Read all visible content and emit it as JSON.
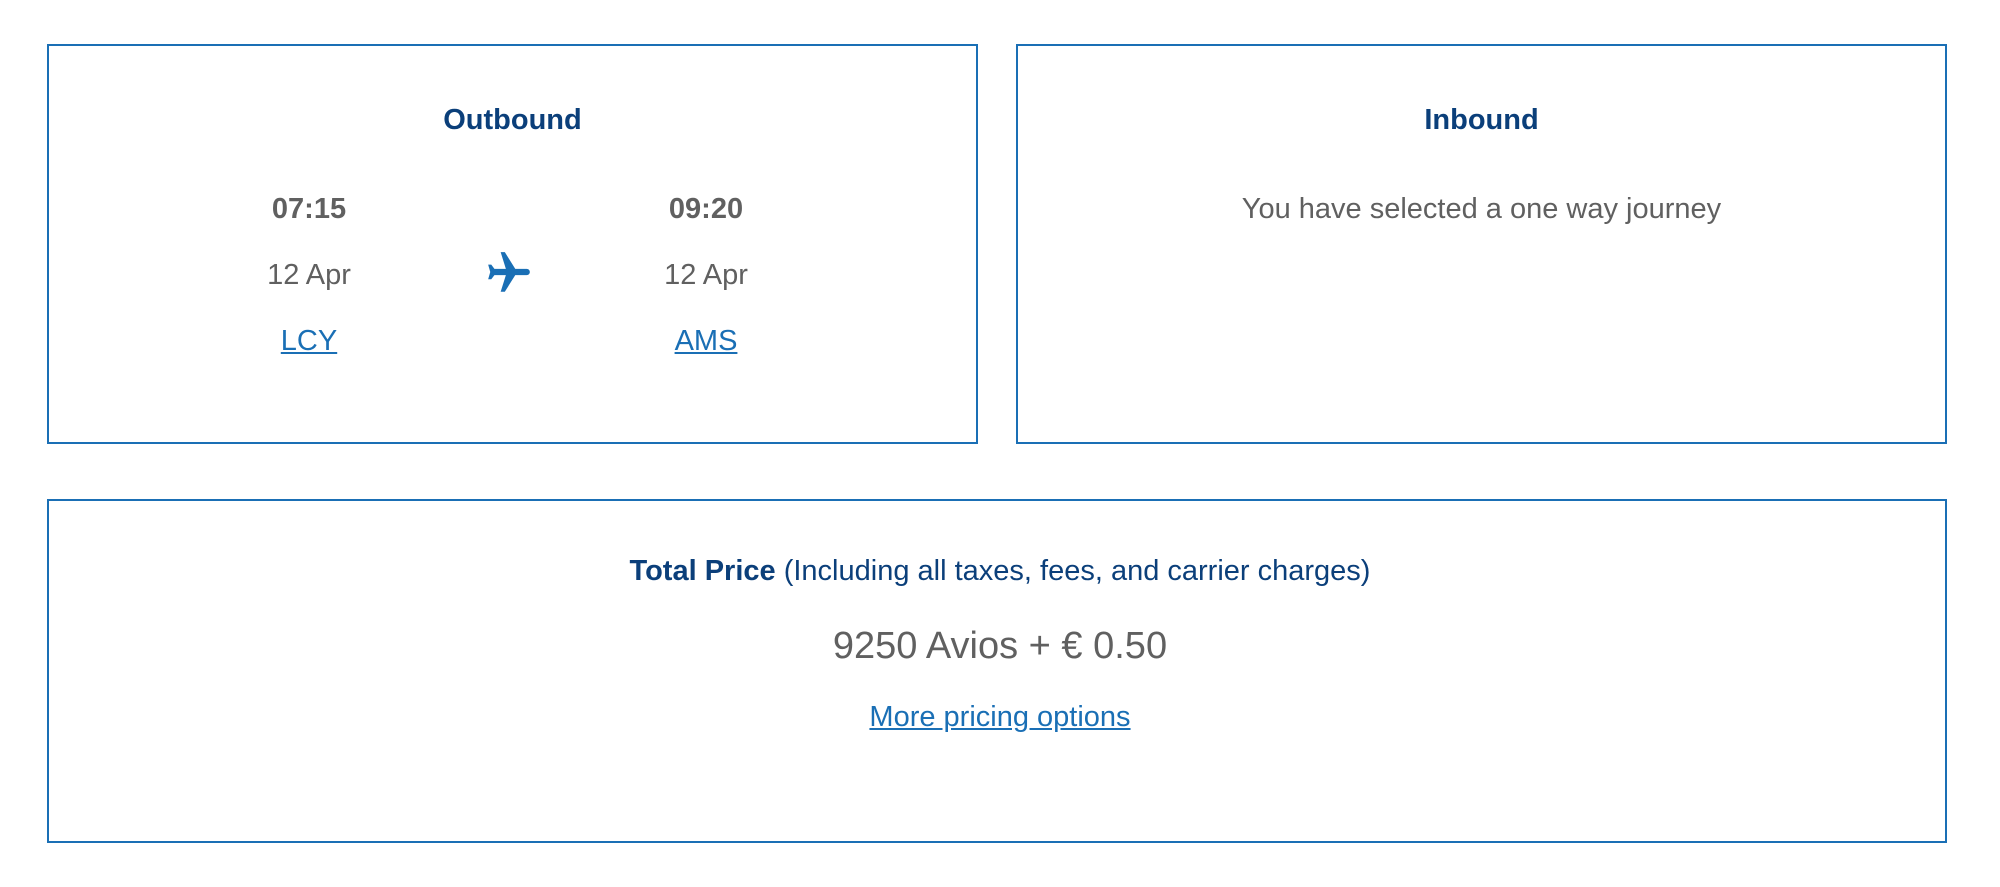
{
  "outbound": {
    "heading": "Outbound",
    "departure": {
      "time": "07:15",
      "date": "12 Apr",
      "airport": "LCY"
    },
    "arrival": {
      "time": "09:20",
      "date": "12 Apr",
      "airport": "AMS"
    },
    "icon": "airplane-icon"
  },
  "inbound": {
    "heading": "Inbound",
    "message": "You have selected a one way journey"
  },
  "price": {
    "label": "Total Price",
    "note": " (Including all taxes, fees, and carrier charges)",
    "value": "9250 Avios + € 0.50",
    "link": "More pricing options"
  },
  "colors": {
    "border": "#1a6fb5",
    "heading": "#0b3f7a",
    "link": "#1a6fb5",
    "text": "#606060"
  }
}
